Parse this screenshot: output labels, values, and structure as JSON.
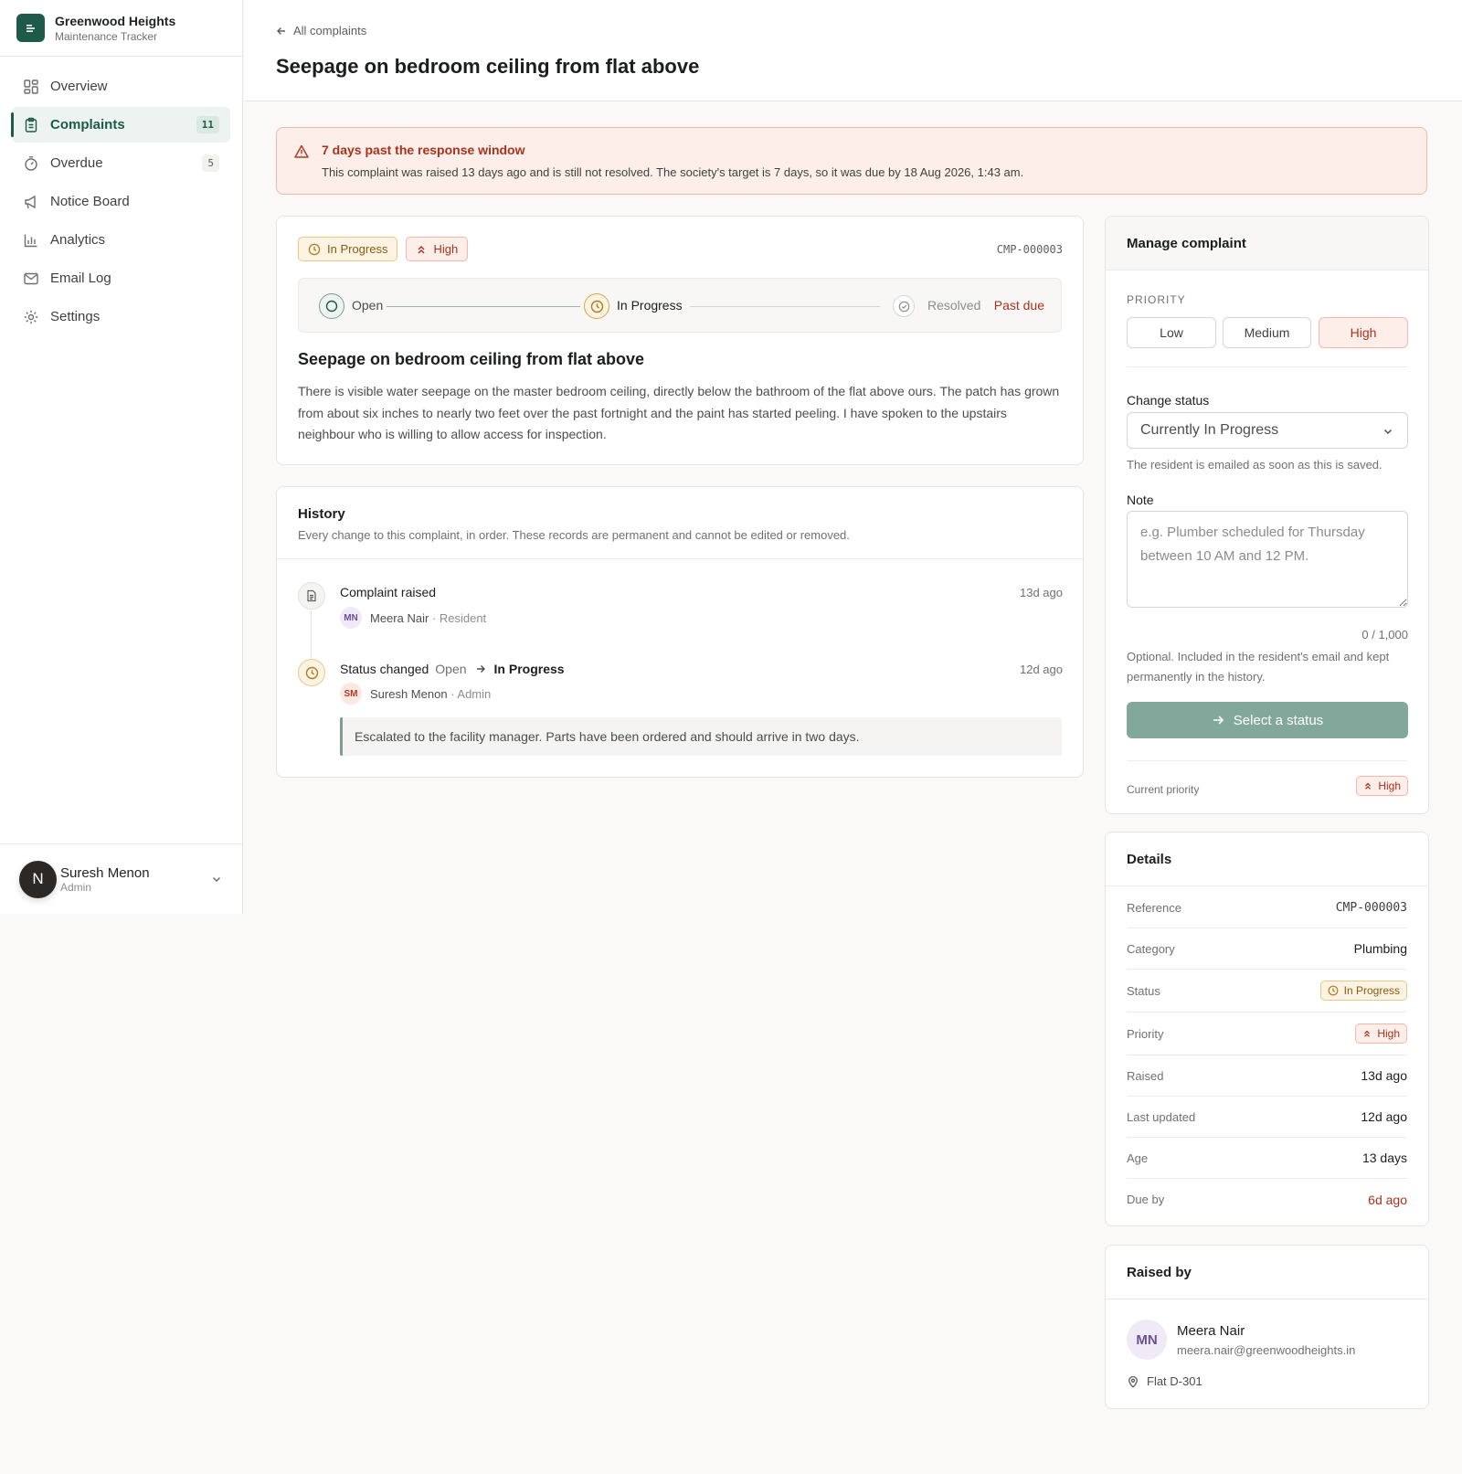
{
  "brand": {
    "title": "Greenwood Heights",
    "subtitle": "Maintenance Tracker"
  },
  "nav": [
    {
      "label": "Overview",
      "icon": "grid-icon",
      "badge": ""
    },
    {
      "label": "Complaints",
      "icon": "clipboard-icon",
      "badge": "11",
      "active": true
    },
    {
      "label": "Overdue",
      "icon": "timer-icon",
      "badge": "5"
    },
    {
      "label": "Notice Board",
      "icon": "megaphone-icon",
      "badge": ""
    },
    {
      "label": "Analytics",
      "icon": "bar-chart-icon",
      "badge": ""
    },
    {
      "label": "Email Log",
      "icon": "mail-icon",
      "badge": ""
    },
    {
      "label": "Settings",
      "icon": "gear-icon",
      "badge": ""
    }
  ],
  "user": {
    "initial": "N",
    "name": "Suresh Menon",
    "role": "Admin"
  },
  "header": {
    "back": "All complaints",
    "title": "Seepage on bedroom ceiling from flat above"
  },
  "alert": {
    "title": "7 days past the response window",
    "text": "This complaint was raised 13 days ago and is still not resolved. The society's target is 7 days, so it was due by 18 Aug 2026, 1:43 am."
  },
  "complaint": {
    "status": "In Progress",
    "priority": "High",
    "reference": "CMP-000003",
    "steps": {
      "open": "Open",
      "in_progress": "In Progress",
      "resolved": "Resolved",
      "past_due": "Past due"
    },
    "title": "Seepage on bedroom ceiling from flat above",
    "description": "There is visible water seepage on the master bedroom ceiling, directly below the bathroom of the flat above ours. The patch has grown from about six inches to nearly two feet over the past fortnight and the paint has started peeling. I have spoken to the upstairs neighbour who is willing to allow access for inspection."
  },
  "history": {
    "title": "History",
    "subtitle": "Every change to this complaint, in order. These records are permanent and cannot be edited or removed.",
    "events": [
      {
        "title": "Complaint raised",
        "time": "13d ago",
        "initials": "MN",
        "actor": "Meera Nair",
        "role": "· Resident"
      },
      {
        "title": "Status changed",
        "from": "Open",
        "to": "In Progress",
        "time": "12d ago",
        "initials": "SM",
        "actor": "Suresh Menon",
        "role": "· Admin",
        "note": "Escalated to the facility manager. Parts have been ordered and should arrive in two days."
      }
    ]
  },
  "manage": {
    "title": "Manage complaint",
    "priority_label": "PRIORITY",
    "priorities": [
      "Low",
      "Medium",
      "High"
    ],
    "change_status_label": "Change status",
    "status_select": "Currently In Progress",
    "status_help": "The resident is emailed as soon as this is saved.",
    "note_label": "Note",
    "note_placeholder": "e.g. Plumber scheduled for Thursday between 10 AM and 12 PM.",
    "note_value": "",
    "counter": "0 / 1,000",
    "note_help": "Optional. Included in the resident's email and kept permanently in the history.",
    "button": "Select a status",
    "current_priority_label": "Current priority",
    "current_priority": "High"
  },
  "details": {
    "title": "Details",
    "rows": [
      {
        "key": "Reference",
        "value": "CMP-000003"
      },
      {
        "key": "Category",
        "value": "Plumbing"
      },
      {
        "key": "Status",
        "value": "In Progress"
      },
      {
        "key": "Priority",
        "value": "High"
      },
      {
        "key": "Raised",
        "value": "13d ago"
      },
      {
        "key": "Last updated",
        "value": "12d ago"
      },
      {
        "key": "Age",
        "value": "13 days"
      },
      {
        "key": "Due by",
        "value": "6d ago"
      }
    ]
  },
  "raised_by": {
    "title": "Raised by",
    "initials": "MN",
    "name": "Meera Nair",
    "email": "meera.nair@greenwoodheights.in",
    "flat": "Flat D-301"
  },
  "colors": {
    "brand": "#1d5a4a",
    "danger": "#a8331c",
    "amber": "#8a5a10",
    "button": "#82a89c"
  }
}
